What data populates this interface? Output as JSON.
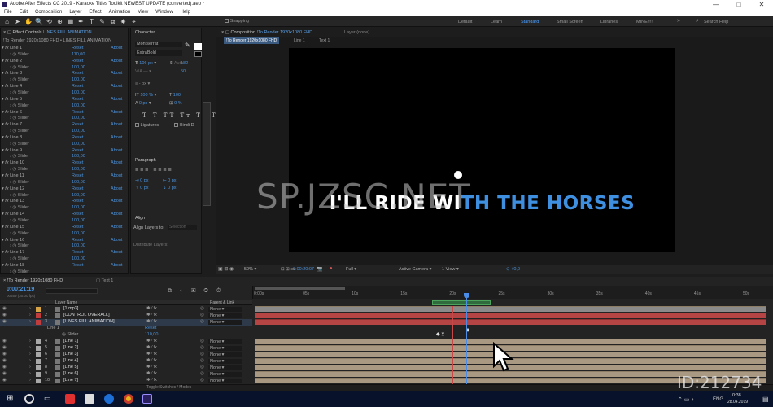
{
  "window": {
    "title": "Adobe After Effects CC 2019 - Karaoke Titles Toolkit NEWEST UPDATE (converted).aep *",
    "min": "—",
    "max": "□",
    "close": "✕"
  },
  "menu": [
    "File",
    "Edit",
    "Composition",
    "Layer",
    "Effect",
    "Animation",
    "View",
    "Window",
    "Help"
  ],
  "toolbar": {
    "snapping": "Snapping",
    "workspaces": [
      "Default",
      "Learn",
      "Standard",
      "Small Screen",
      "Libraries",
      "MINE!!!!"
    ],
    "active_ws": "Standard",
    "search_placeholder": "Search Help"
  },
  "effect_controls": {
    "tab": "Effect Controls",
    "tab_target": "LINES FILL ANIMATION",
    "header": "!To Render 1920x1080 FHD • LINES FILL ANIMATION",
    "rows": [
      {
        "fx": "Line 1",
        "slider": "Slider",
        "val": "110,00"
      },
      {
        "fx": "Line 2",
        "slider": "Slider",
        "val": "100,00"
      },
      {
        "fx": "Line 3",
        "slider": "Slider",
        "val": "100,00"
      },
      {
        "fx": "Line 4",
        "slider": "Slider",
        "val": "100,00"
      },
      {
        "fx": "Line 5",
        "slider": "Slider",
        "val": "100,00"
      },
      {
        "fx": "Line 6",
        "slider": "Slider",
        "val": "100,00"
      },
      {
        "fx": "Line 7",
        "slider": "Slider",
        "val": "100,00"
      },
      {
        "fx": "Line 8",
        "slider": "Slider",
        "val": "100,00"
      },
      {
        "fx": "Line 9",
        "slider": "Slider",
        "val": "100,00"
      },
      {
        "fx": "Line 10",
        "slider": "Slider",
        "val": "100,00"
      },
      {
        "fx": "Line 11",
        "slider": "Slider",
        "val": "100,00"
      },
      {
        "fx": "Line 12",
        "slider": "Slider",
        "val": "100,00"
      },
      {
        "fx": "Line 13",
        "slider": "Slider",
        "val": "100,00"
      },
      {
        "fx": "Line 14",
        "slider": "Slider",
        "val": "100,00"
      },
      {
        "fx": "Line 15",
        "slider": "Slider",
        "val": "100,00"
      },
      {
        "fx": "Line 16",
        "slider": "Slider",
        "val": "100,00"
      },
      {
        "fx": "Line 17",
        "slider": "Slider",
        "val": "100,00"
      },
      {
        "fx": "Line 18",
        "slider": "Slider"
      }
    ],
    "reset": "Reset",
    "about": "About"
  },
  "character": {
    "tab": "Character",
    "font": "Montserrat",
    "style": "ExtraBold",
    "size": "106 px",
    "leading": "Auto",
    "tracking": "182",
    "kerning": "50",
    "stroke": "- px",
    "vscale": "100 %",
    "hscale": "100",
    "baseline": "0 px",
    "tsume": "0 %",
    "ligatures": "Ligatures",
    "hindi": "Hindi D"
  },
  "paragraph": {
    "tab": "Paragraph",
    "v1": "0 px",
    "v2": "0 px",
    "v3": "0 px",
    "v4": "0 px",
    "v5": "0 px"
  },
  "align": {
    "tab": "Align",
    "align_to_label": "Align Layers to:",
    "align_to": "Selection",
    "distribute": "Distribute Layers:"
  },
  "composition": {
    "tab": "Composition",
    "tab_name": "!To Render 1920x1080 FHD",
    "breadcrumbs": [
      "!To Render 1920x1080 FHD",
      "Line 1",
      "Text 1"
    ],
    "layer_tab": "Layer (none)",
    "lyric_white": "I'LL RIDE WI",
    "lyric_blue": "TH THE HORSES",
    "zoom": "50%",
    "timecode": "0:00:20:07",
    "resolution": "Full",
    "camera": "Active Camera",
    "views": "1 View",
    "exposure": "+0,0"
  },
  "watermark": "SP.JZSC.NET",
  "timeline": {
    "tab": "!To Render 1920x1080 FHD",
    "tab2": "Text 1",
    "timecode": "0:00:21:19",
    "frames": "00659 (30.00 fps)",
    "headers": {
      "name": "Layer Name",
      "parent": "Parent & Link"
    },
    "ruler": [
      "0:00s",
      "05s",
      "10s",
      "15s",
      "20s",
      "25s",
      "30s",
      "35s",
      "40s",
      "45s",
      "50s"
    ],
    "layers": [
      {
        "num": "1",
        "name": "[1.mp3]",
        "parent": "None",
        "color": "#d6a447"
      },
      {
        "num": "2",
        "name": "[CONTROL OVERALL]",
        "parent": "None",
        "color": "#c13d3d"
      },
      {
        "num": "3",
        "name": "[LINES FILL ANIMATION]",
        "parent": "None",
        "color": "#c13d3d"
      },
      {
        "num": "4",
        "name": "[Line 1]",
        "parent": "None",
        "color": "#a8a8a8"
      },
      {
        "num": "5",
        "name": "[Line 2]",
        "parent": "None",
        "color": "#a8a8a8"
      },
      {
        "num": "6",
        "name": "[Line 3]",
        "parent": "None",
        "color": "#a8a8a8"
      },
      {
        "num": "7",
        "name": "[Line 4]",
        "parent": "None",
        "color": "#a8a8a8"
      },
      {
        "num": "8",
        "name": "[Line 5]",
        "parent": "None",
        "color": "#a8a8a8"
      },
      {
        "num": "9",
        "name": "[Line 6]",
        "parent": "None",
        "color": "#a8a8a8"
      },
      {
        "num": "10",
        "name": "[Line 7]",
        "parent": "None",
        "color": "#a8a8a8"
      }
    ],
    "sub_line": "Line 1",
    "sub_slider": "Slider",
    "sub_reset": "Reset",
    "sub_val": "110,00",
    "footer": "Toggle Switches / Modes"
  },
  "taskbar": {
    "lang": "ENG",
    "time": "0:38",
    "date": "28.04.2019"
  },
  "id_watermark": "ID:212734"
}
